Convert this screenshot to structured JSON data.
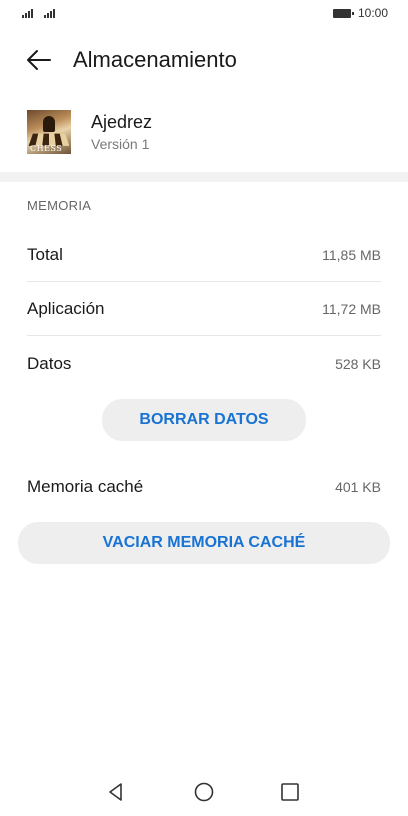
{
  "status_bar": {
    "time": "10:00",
    "icons": [
      "signal-icon",
      "signal-icon",
      "battery-icon"
    ]
  },
  "app_bar": {
    "title": "Almacenamiento",
    "back_icon": "back-arrow-icon"
  },
  "app_info": {
    "name": "Ajedrez",
    "version": "Versión 1",
    "icon_text": "CHESS"
  },
  "memory": {
    "section_label": "MEMORIA",
    "rows": [
      {
        "label": "Total",
        "value": "11,85 MB"
      },
      {
        "label": "Aplicación",
        "value": "11,72 MB"
      },
      {
        "label": "Datos",
        "value": "528 KB"
      }
    ],
    "clear_data_label": "BORRAR DATOS",
    "cache_label": "Memoria caché",
    "cache_value": "401 KB",
    "clear_cache_label": "VACIAR MEMORIA CACHÉ"
  },
  "navigation": {
    "icons": [
      "nav-back-icon",
      "nav-home-icon",
      "nav-recent-icon"
    ]
  },
  "colors": {
    "accent": "#1873d3",
    "button_bg": "#eeeeee",
    "divider": "#f2f2f2"
  }
}
